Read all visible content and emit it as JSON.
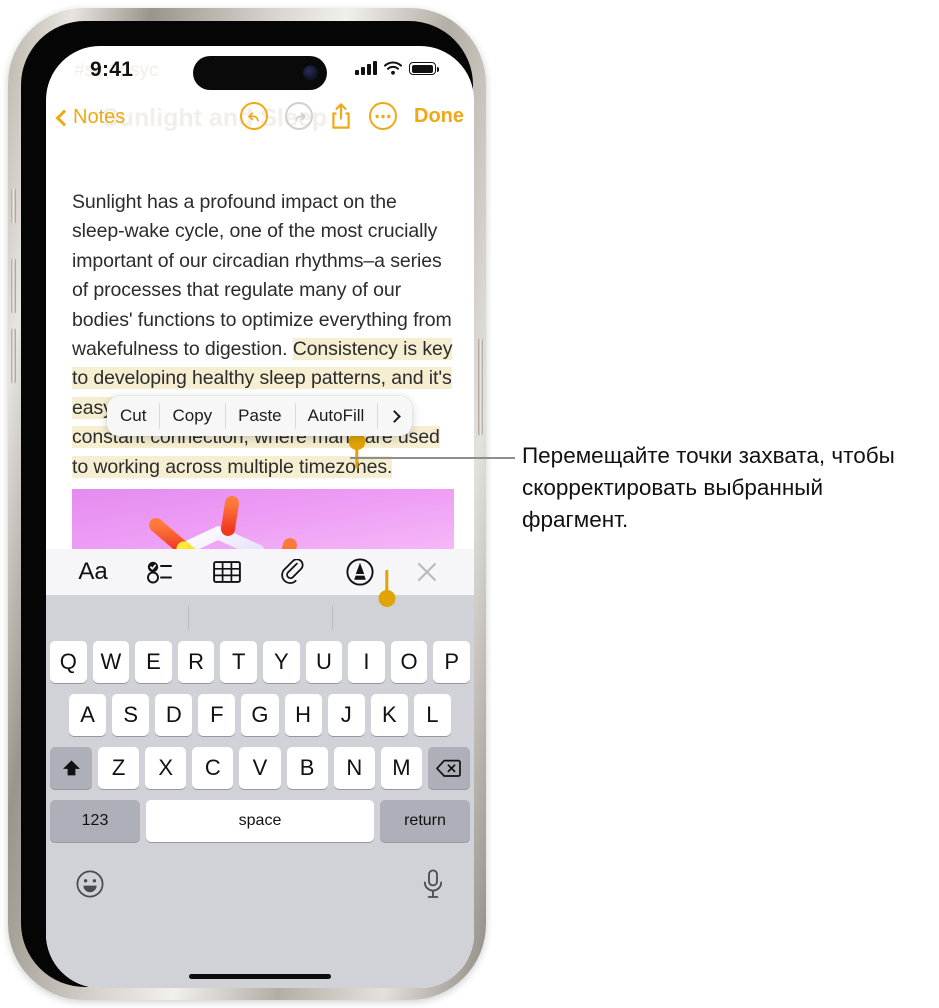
{
  "status_bar": {
    "time": "9:41",
    "ghost_tags": "#sc    #psyc",
    "signal_icon": "cellular-bars-icon",
    "wifi_icon": "wifi-icon",
    "battery_icon": "battery-icon"
  },
  "nav_bar": {
    "back_label": "Notes",
    "ghost_title": "Sunlight and Sleep",
    "undo_icon": "undo-arrow-icon",
    "redo_icon": "redo-arrow-icon",
    "share_icon": "share-icon",
    "more_icon": "ellipsis-icon",
    "done_label": "Done"
  },
  "note": {
    "paragraph_before": "Sunlight has a profound impact on the sleep-wake cycle, one of the most crucially important of our circadian rhythms–a series of processes that regulate many of our bodies' functions to optimize everything from wakefulness to digestion. ",
    "selected_text": "Consistency is key to developing healthy sleep patterns, and it's easy to slip out of sync in a world of constant connection, where many are used to working across multiple timezones.",
    "highlight_color": "#f6eed1",
    "handle_color": "#e0a408",
    "attachment_alt": "molecule-illustration"
  },
  "context_menu": {
    "items": [
      {
        "label": "Cut"
      },
      {
        "label": "Copy"
      },
      {
        "label": "Paste"
      },
      {
        "label": "AutoFill"
      }
    ],
    "more_icon": "chevron-right-icon"
  },
  "format_toolbar": {
    "buttons": [
      {
        "name": "text-format-button",
        "label": "Aa",
        "icon": "aa-icon"
      },
      {
        "name": "checklist-button",
        "label": "",
        "icon": "checklist-icon"
      },
      {
        "name": "table-button",
        "label": "",
        "icon": "table-icon"
      },
      {
        "name": "attachment-button",
        "label": "",
        "icon": "paperclip-icon"
      },
      {
        "name": "markup-button",
        "label": "",
        "icon": "markup-pen-icon"
      },
      {
        "name": "close-keyboard-button",
        "label": "",
        "icon": "close-icon"
      }
    ]
  },
  "keyboard": {
    "row1": [
      "Q",
      "W",
      "E",
      "R",
      "T",
      "Y",
      "U",
      "I",
      "O",
      "P"
    ],
    "row2": [
      "A",
      "S",
      "D",
      "F",
      "G",
      "H",
      "J",
      "K",
      "L"
    ],
    "row3": [
      "Z",
      "X",
      "C",
      "V",
      "B",
      "N",
      "M"
    ],
    "shift_icon": "shift-up-arrow-icon",
    "backspace_icon": "backspace-icon",
    "numbers_label": "123",
    "space_label": "space",
    "return_label": "return",
    "emoji_icon": "emoji-smiley-icon",
    "dictation_icon": "microphone-icon"
  },
  "callout": {
    "text": "Перемещайте точки захвата, чтобы скорректировать выбранный фрагмент."
  },
  "colors": {
    "accent": "#f0a816",
    "selection": "#f6eed1",
    "keyboard_bg": "#d1d2d8"
  }
}
